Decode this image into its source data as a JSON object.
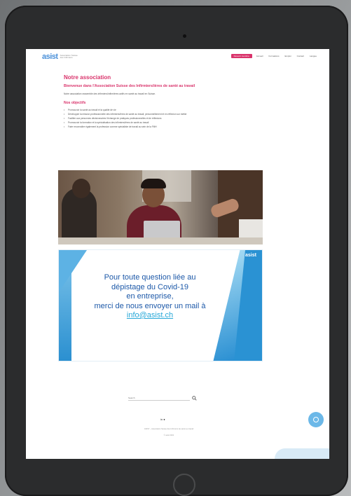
{
  "nav": {
    "logo_mark": "asist",
    "logo_sub": "Association Suisse des Infirmiers",
    "cta": "Devenir membre",
    "items": [
      "Accueil",
      "Formations",
      "Emploi",
      "Contact",
      "Langue"
    ]
  },
  "content": {
    "title": "Notre association",
    "subtitle": "Bienvenue dans l'Association Suisse des Infirmiers/ières de santé au travail",
    "intro": "Notre association rassemble des infirmiers/infirmières actifs en santé au travail en Suisse.",
    "objectives_title": "Nos objectifs",
    "objectives": [
      "Promouvoir la santé au travail et la qualité de vie",
      "Développer la mission professionnelle des infirmiers/ières de santé au travail, personnellement et en réflexion sur métier",
      "Faciliter aux personnes décisionnaires l'échange de pratiques professionnelles et de réflexions",
      "Promouvoir la formation et la spécialisation des infirmiers/ières de santé au travail",
      "Faire reconnaître également la profession comme spécialiste de travail au sein de la FMH"
    ]
  },
  "banner": {
    "logo": "asist",
    "line1": "Pour toute question liée au",
    "line2": "dépistage du Covid-19",
    "line3": "en entreprise,",
    "line4": "merci de nous envoyer un mail à",
    "email": "info@asist.ch"
  },
  "footer": {
    "search_placeholder": "Search",
    "social": "in ●",
    "line1": "ASIST – Association Suisse des Infirmiers de santé au travail",
    "line2": "© asist 2021"
  },
  "colors": {
    "accent": "#d9336b",
    "banner_text": "#1c58a8",
    "link": "#28a8d8"
  }
}
